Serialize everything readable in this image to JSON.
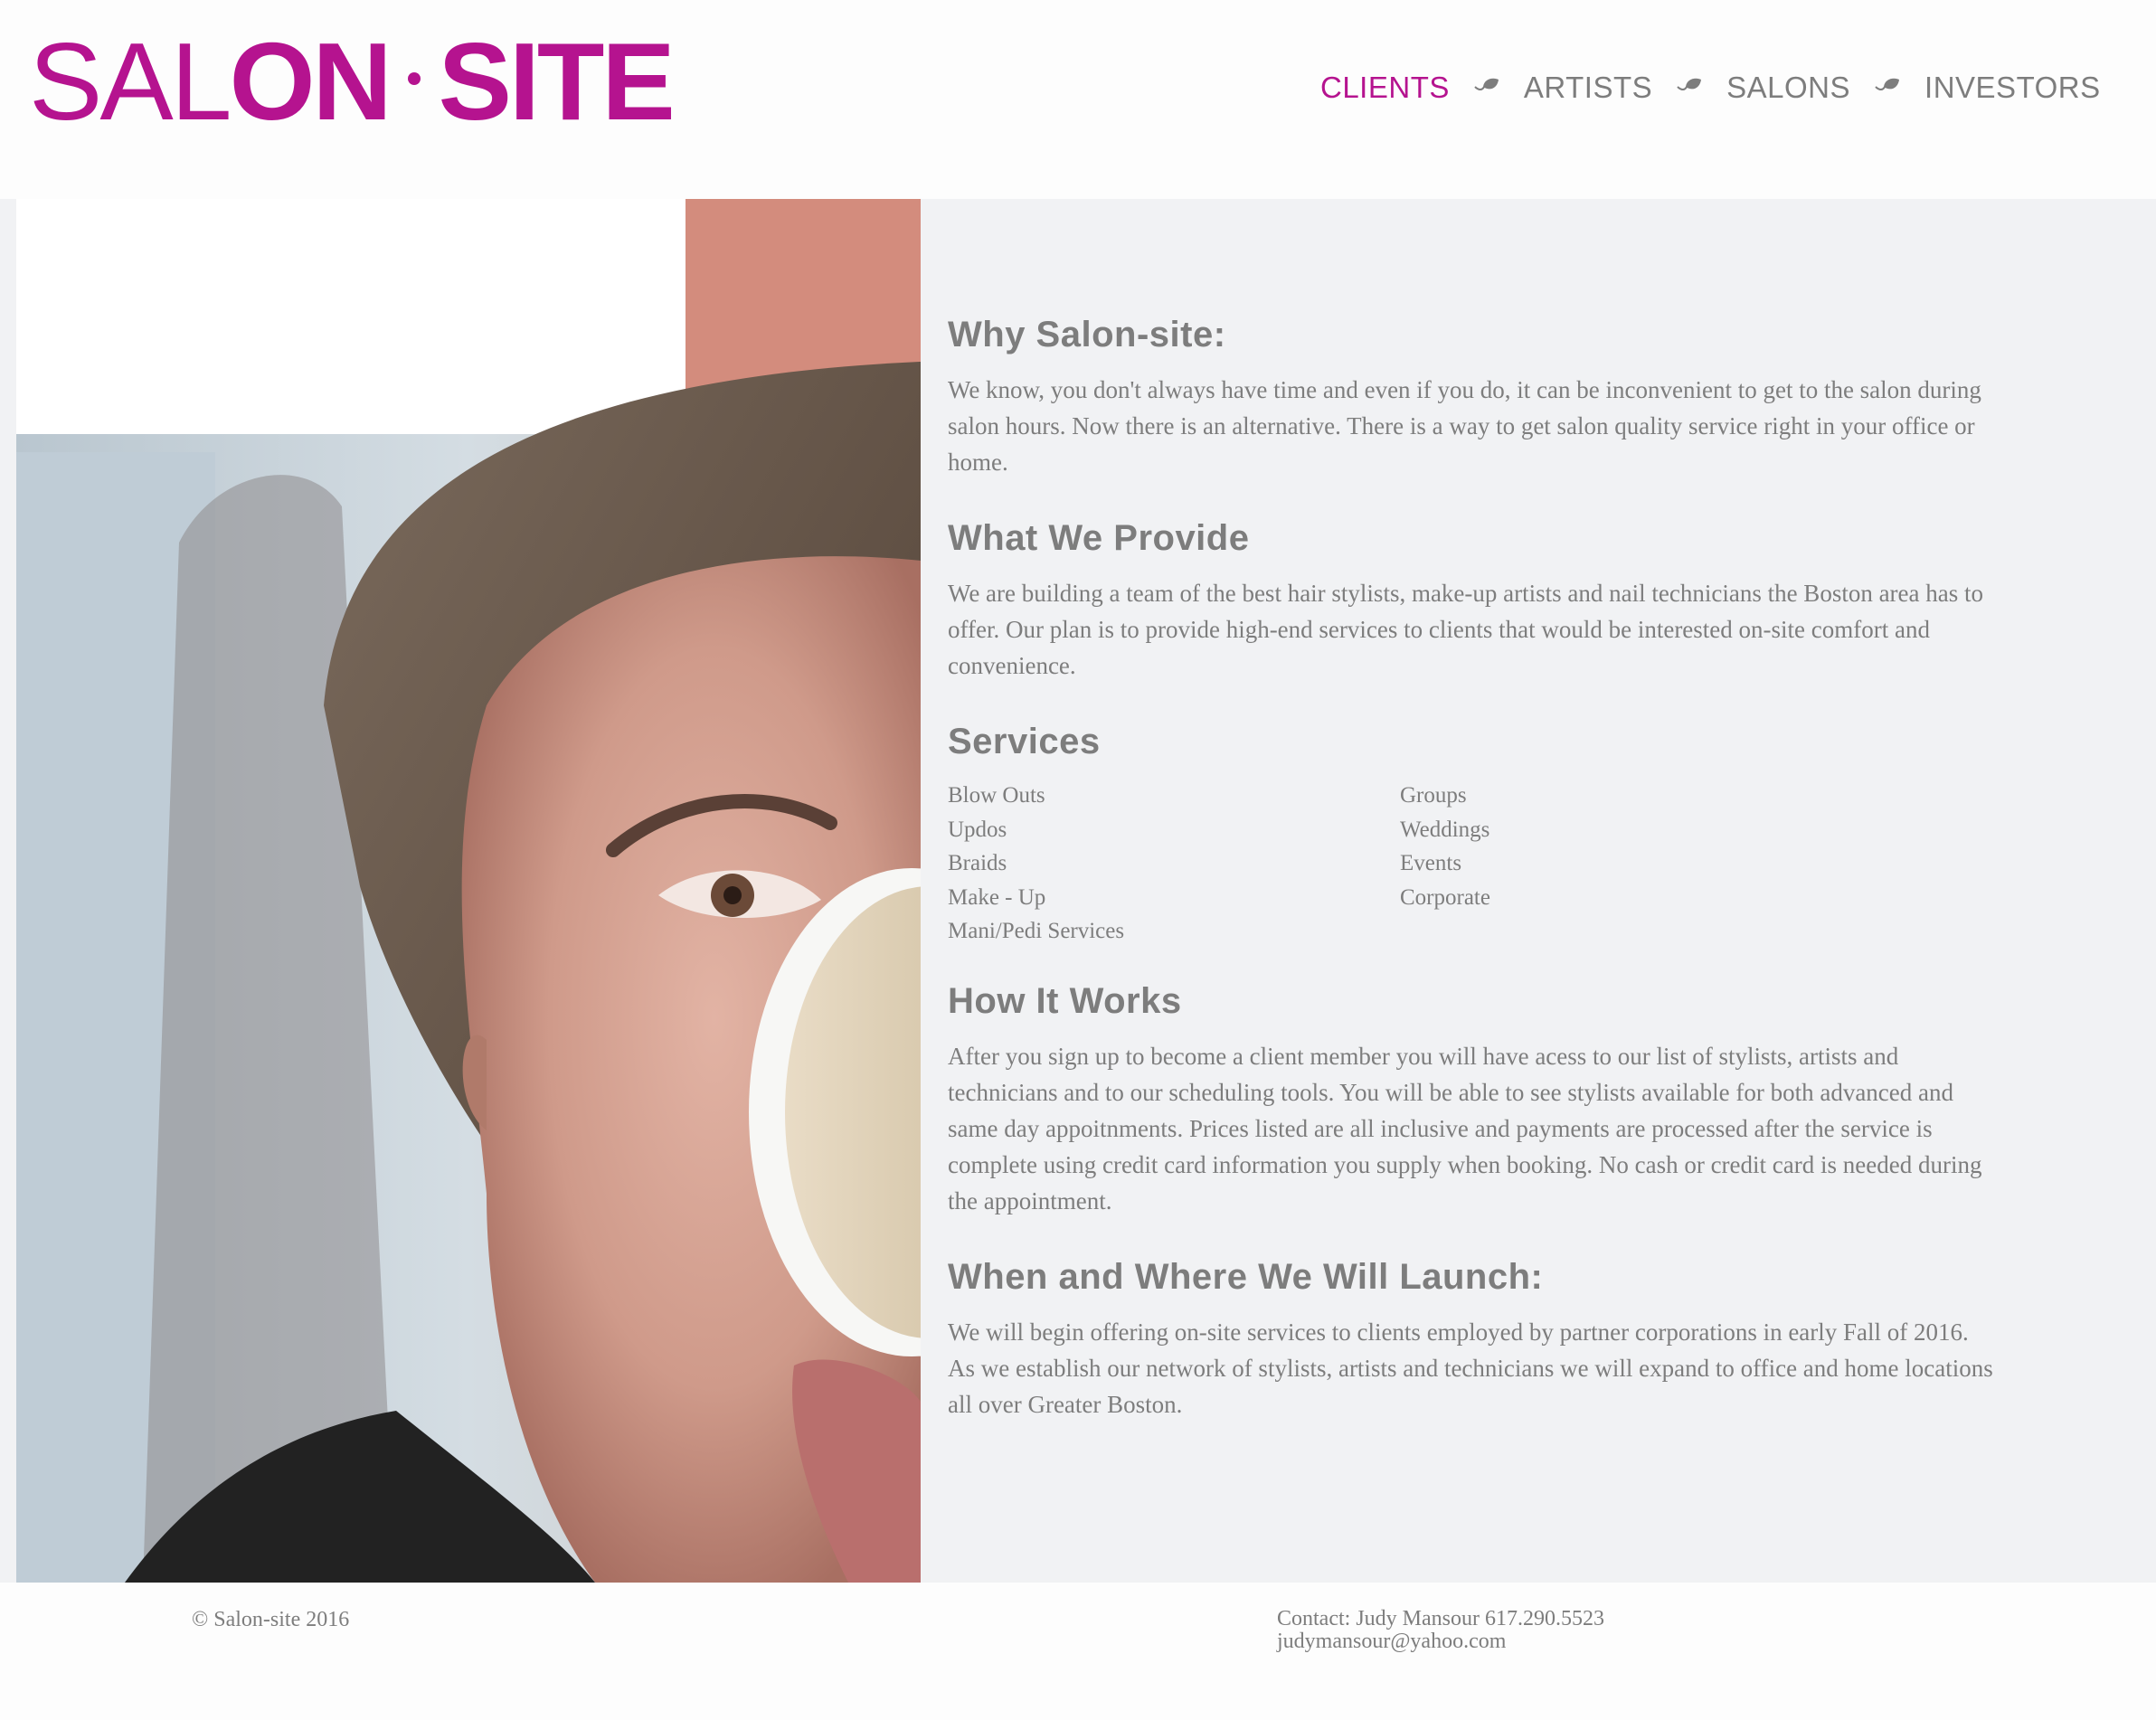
{
  "logo": {
    "part1": "SAL",
    "part2": "ON",
    "part3": "SITE"
  },
  "nav": {
    "items": [
      {
        "label": "CLIENTS",
        "active": true
      },
      {
        "label": "ARTISTS",
        "active": false
      },
      {
        "label": "SALONS",
        "active": false
      },
      {
        "label": "INVESTORS",
        "active": false
      }
    ]
  },
  "colors": {
    "brand": "#b5138f",
    "text": "#7d7d7d",
    "panel_bg": "#f1f2f4"
  },
  "sections": {
    "why": {
      "heading": "Why Salon-site:",
      "body": "We know, you don't always have time and even if you do, it can be inconvenient to get to the salon during salon hours. Now there is an alternative. There is a way to get salon quality service right in your office or home."
    },
    "provide": {
      "heading": "What We Provide",
      "body": "We are building a team of the best hair stylists, make-up artists and nail technicians the Boston area has to offer. Our plan is to provide high-end services to clients that would be interested on-site comfort and convenience."
    },
    "services": {
      "heading": "Services",
      "left": [
        "Blow Outs",
        "Updos",
        "Braids",
        "Make - Up",
        "Mani/Pedi Services"
      ],
      "right": [
        "Groups",
        "Weddings",
        "Events",
        "Corporate"
      ]
    },
    "how": {
      "heading": "How It Works",
      "body": "After you sign up to become a client member you will have acess to our list of stylists, artists and technicians and to our scheduling tools. You will be able to see stylists available for both advanced and same day appoitnments. Prices listed are all inclusive and payments are processed after the service is complete using credit card information you supply when booking. No cash or credit card is needed during the appointment."
    },
    "launch": {
      "heading": "When and Where We Will Launch:",
      "body": "We will begin offering on-site services to clients employed by partner corporations in early Fall of 2016. As we establish our network of stylists, artists and technicians we will expand to office and home locations all over Greater Boston."
    }
  },
  "footer": {
    "copyright": "© Salon-site 2016",
    "contact_line1": "Contact: Judy Mansour 617.290.5523",
    "contact_line2": "judymansour@yahoo.com"
  }
}
